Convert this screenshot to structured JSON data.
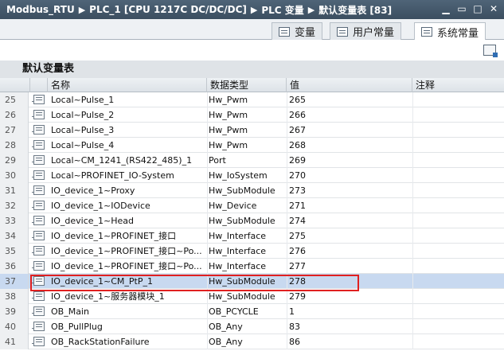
{
  "breadcrumb": {
    "items": [
      "Modbus_RTU",
      "PLC_1 [CPU 1217C DC/DC/DC]",
      "PLC 变量",
      "默认变量表 [83]"
    ],
    "separator": "▶"
  },
  "window_controls": [
    "minimize-icon",
    "restore-icon",
    "maximize-icon",
    "close-icon"
  ],
  "tabs": [
    {
      "label": "变量",
      "icon": "variable-table-icon",
      "active": false
    },
    {
      "label": "用户常量",
      "icon": "user-constant-icon",
      "active": false
    },
    {
      "label": "系统常量",
      "icon": "system-constant-icon",
      "active": true
    }
  ],
  "table_title": "默认变量表",
  "columns": [
    "名称",
    "数据类型",
    "值",
    "注释"
  ],
  "rows": [
    {
      "num": "25",
      "name": "Local~Pulse_1",
      "type": "Hw_Pwm",
      "value": "265"
    },
    {
      "num": "26",
      "name": "Local~Pulse_2",
      "type": "Hw_Pwm",
      "value": "266"
    },
    {
      "num": "27",
      "name": "Local~Pulse_3",
      "type": "Hw_Pwm",
      "value": "267"
    },
    {
      "num": "28",
      "name": "Local~Pulse_4",
      "type": "Hw_Pwm",
      "value": "268"
    },
    {
      "num": "29",
      "name": "Local~CM_1241_(RS422_485)_1",
      "type": "Port",
      "value": "269"
    },
    {
      "num": "30",
      "name": "Local~PROFINET_IO-System",
      "type": "Hw_IoSystem",
      "value": "270"
    },
    {
      "num": "31",
      "name": "IO_device_1~Proxy",
      "type": "Hw_SubModule",
      "value": "273"
    },
    {
      "num": "32",
      "name": "IO_device_1~IODevice",
      "type": "Hw_Device",
      "value": "271"
    },
    {
      "num": "33",
      "name": "IO_device_1~Head",
      "type": "Hw_SubModule",
      "value": "274"
    },
    {
      "num": "34",
      "name": "IO_device_1~PROFINET_接口",
      "type": "Hw_Interface",
      "value": "275"
    },
    {
      "num": "35",
      "name": "IO_device_1~PROFINET_接口~Po...",
      "type": "Hw_Interface",
      "value": "276"
    },
    {
      "num": "36",
      "name": "IO_device_1~PROFINET_接口~Po...",
      "type": "Hw_Interface",
      "value": "277"
    },
    {
      "num": "37",
      "name": "IO_device_1~CM_PtP_1",
      "type": "Hw_SubModule",
      "value": "278",
      "selected": true
    },
    {
      "num": "38",
      "name": "IO_device_1~服务器模块_1",
      "type": "Hw_SubModule",
      "value": "279"
    },
    {
      "num": "39",
      "name": "OB_Main",
      "type": "OB_PCYCLE",
      "value": "1"
    },
    {
      "num": "40",
      "name": "OB_PullPlug",
      "type": "OB_Any",
      "value": "83"
    },
    {
      "num": "41",
      "name": "OB_RackStationFailure",
      "type": "OB_Any",
      "value": "86"
    }
  ],
  "highlight_color": "#e02020",
  "selected_row_color": "#c8d9f0"
}
